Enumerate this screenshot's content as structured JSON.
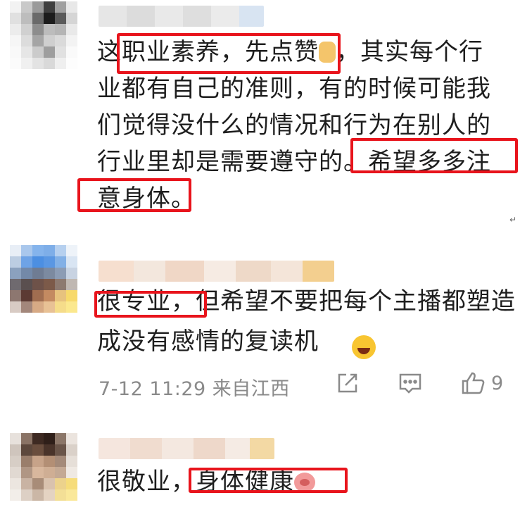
{
  "comments": [
    {
      "avatar_name": "blurred-avatar",
      "text": "这职业素养，先点赞",
      "text_rest": "，其实每个行业都有自己的准则，有的时候可能我们觉得没什么的情况和行为在别人的行业里却是需要遵守的。希望多多注意身体。"
    },
    {
      "text": "很专业，但希望不要把每个主播都塑造成没有感情的复读机",
      "meta": "7-12 11:29 来自江西",
      "like_count": "9"
    },
    {
      "text": "很敬业，身体健康"
    }
  ],
  "colors": {
    "highlight": "#e8141c",
    "meta_text": "#8a8a8a",
    "body_text": "#1e1e1e"
  },
  "icons": [
    "share-icon",
    "comment-icon",
    "like-icon"
  ],
  "misc": {
    "pilcrow": "↵"
  }
}
